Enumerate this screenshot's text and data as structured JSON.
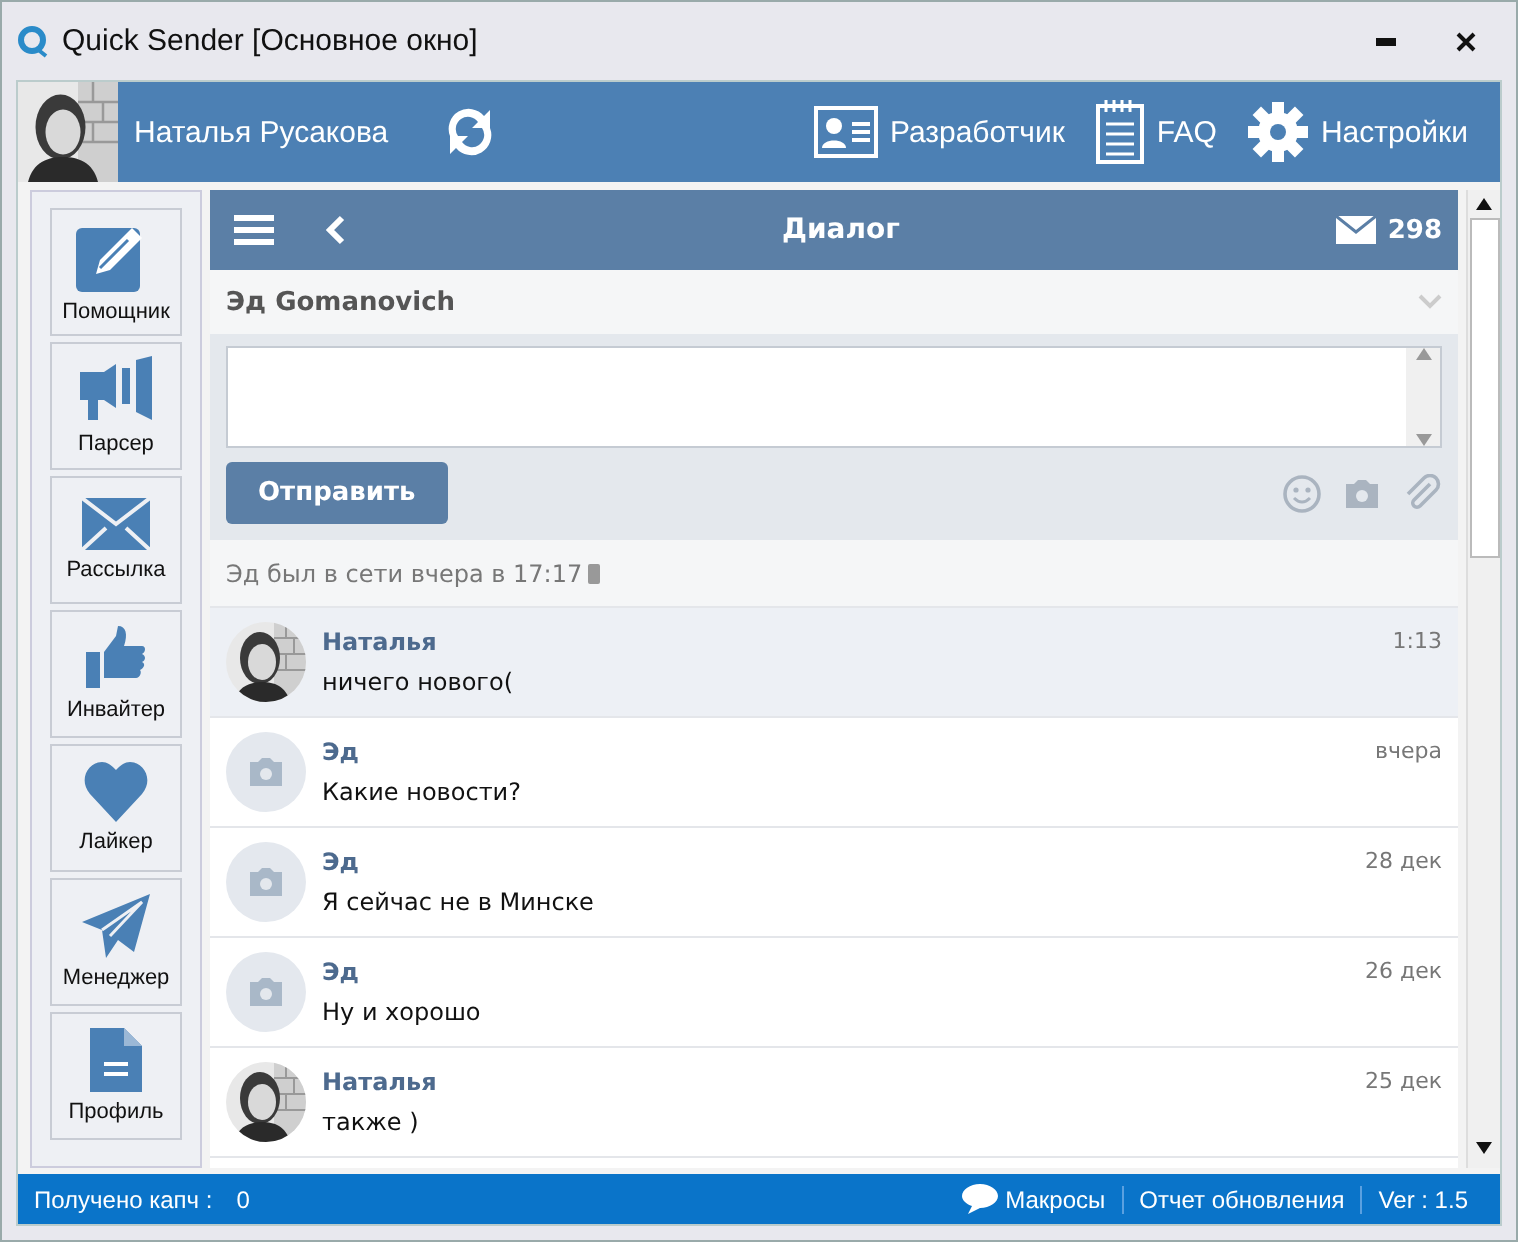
{
  "window": {
    "title": "Quick Sender [Основное окно]"
  },
  "header": {
    "user_name": "Наталья Русакова",
    "links": [
      {
        "kind": "developer",
        "label": "Разработчик"
      },
      {
        "kind": "faq",
        "label": "FAQ"
      },
      {
        "kind": "settings",
        "label": "Настройки"
      }
    ]
  },
  "sidebar": {
    "items": [
      {
        "kind": "pencil",
        "label": "Помощник"
      },
      {
        "kind": "megaphone",
        "label": "Парсер"
      },
      {
        "kind": "mail",
        "label": "Рассылка"
      },
      {
        "kind": "thumb",
        "label": "Инвайтер"
      },
      {
        "kind": "heart",
        "label": "Лайкер"
      },
      {
        "kind": "plane",
        "label": "Менеджер"
      },
      {
        "kind": "file",
        "label": "Профиль"
      }
    ]
  },
  "dialog": {
    "title": "Диалог",
    "message_count": "298",
    "contact": "Эд Gomanovich",
    "send_button": "Отправить",
    "last_seen": "Эд был в сети вчера в 17:17"
  },
  "messages": [
    {
      "sender": "Наталья",
      "text": "ничего нового(",
      "time": "1:13",
      "unread": true
    },
    {
      "sender": "Эд",
      "kind": "placeholder",
      "text": "Какие новости?",
      "time": "вчера",
      "unread": false
    },
    {
      "sender": "Эд",
      "kind": "placeholder",
      "text": "Я сейчас не в Минске",
      "time": "28 дек",
      "unread": false
    },
    {
      "sender": "Эд",
      "kind": "placeholder",
      "text": "Ну и хорошо",
      "time": "26 дек",
      "unread": false
    },
    {
      "sender": "Наталья",
      "text": "также )",
      "time": "25 дек",
      "unread": false
    }
  ],
  "status_bar": {
    "captcha_label": "Получено капч :",
    "captcha_count": "0",
    "macros": "Макросы",
    "update_report": "Отчет обновления",
    "version": "Ver : 1.5"
  }
}
